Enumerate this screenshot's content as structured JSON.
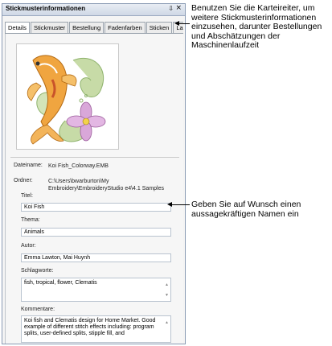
{
  "panel": {
    "title": "Stickmusterinformationen",
    "pin_icon": "⇩",
    "close_icon": "×",
    "tabs": [
      {
        "label": "Details",
        "active": true
      },
      {
        "label": "Stickmuster",
        "active": false
      },
      {
        "label": "Bestellung",
        "active": false
      },
      {
        "label": "Fadenfarben",
        "active": false
      },
      {
        "label": "Sticken",
        "active": false
      },
      {
        "label": "Laufzeit",
        "active": false
      }
    ],
    "preview": {
      "icon": "koi-fish-embroidery"
    },
    "details": {
      "dateiname_label": "Dateiname:",
      "dateiname_value": "Koi Fish_Colorway.EMB",
      "ordner_label": "Ordner:",
      "ordner_value": "C:\\Users\\bwarburton\\My Embroidery\\EmbroideryStudio e4\\4.1 Samples",
      "titel_label": "Titel:",
      "titel_value": "Koi Fish",
      "thema_label": "Thema:",
      "thema_value": "Animals",
      "autor_label": "Autor:",
      "autor_value": "Emma Lawton, Mai Huynh",
      "schlagworte_label": "Schlagworte:",
      "schlagworte_value": "fish, tropical, flower, Clematis",
      "kommentare_label": "Kommentare:",
      "kommentare_value": "Koi fish and Clematis design for Home Market. Good example of different stitch effects including: program splits, user-defined splits, stipple fill, and"
    }
  },
  "callouts": {
    "tabs_note": "Benutzen Sie die Karteireiter, um weitere Stickmusterinformationen einzusehen, darunter Bestellungen und Abschätzungen der Maschinenlaufzeit",
    "title_note": "Geben Sie auf Wunsch einen aussagekräftigen Namen ein"
  }
}
